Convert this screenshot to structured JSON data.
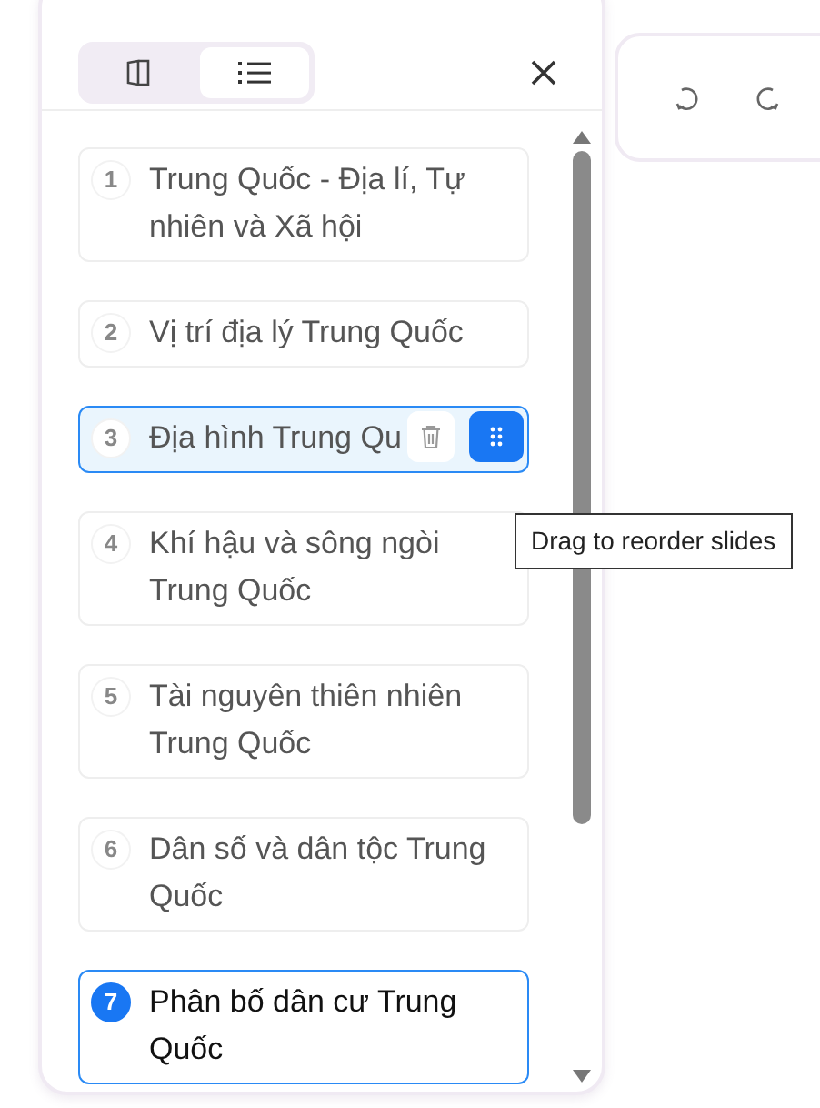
{
  "view_toggle": [
    {
      "kind": "book",
      "selected": false
    },
    {
      "kind": "list",
      "selected": true
    }
  ],
  "slides": [
    {
      "number": "1",
      "title": "Trung Quốc - Địa lí, Tự nhiên và Xã hội",
      "selected": false,
      "hovered": false
    },
    {
      "number": "2",
      "title": "Vị trí địa lý Trung Quốc",
      "selected": false,
      "hovered": false
    },
    {
      "number": "3",
      "title": "Địa hình Trung Qu",
      "selected": false,
      "hovered": true
    },
    {
      "number": "4",
      "title": "Khí hậu và sông ngòi Trung Quốc",
      "selected": false,
      "hovered": false
    },
    {
      "number": "5",
      "title": "Tài nguyên thiên nhiên Trung Quốc",
      "selected": false,
      "hovered": false
    },
    {
      "number": "6",
      "title": "Dân số và dân tộc Trung Quốc",
      "selected": false,
      "hovered": false
    },
    {
      "number": "7",
      "title": "Phân bố dân cư Trung Quốc",
      "selected": true,
      "hovered": false
    }
  ],
  "tooltip": "Drag to reorder slides"
}
